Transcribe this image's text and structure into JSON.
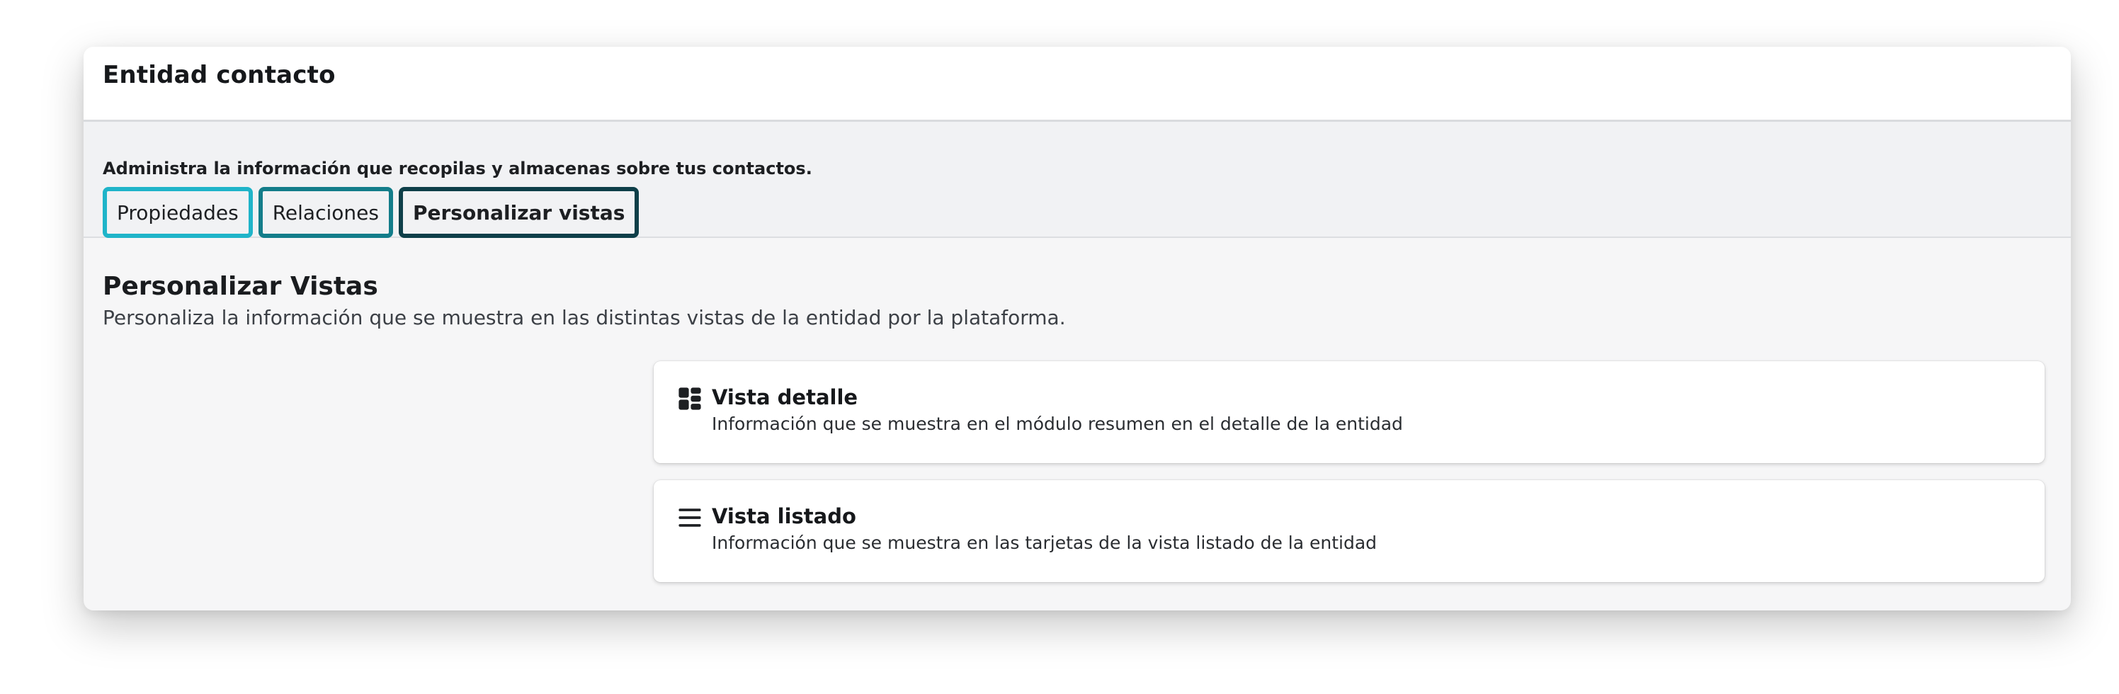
{
  "header": {
    "title": "Entidad contacto"
  },
  "subheader": {
    "description": "Administra la información que recopilas y almacenas sobre tus contactos.",
    "tabs": [
      {
        "label": "Propiedades",
        "color": "#1fb4c9"
      },
      {
        "label": "Relaciones",
        "color": "#137d8a"
      },
      {
        "label": "Personalizar vistas",
        "color": "#0e3f49",
        "active": true
      }
    ]
  },
  "section": {
    "title": "Personalizar Vistas",
    "description": "Personaliza la información que se muestra en las distintas vistas de la entidad por la plataforma."
  },
  "cards": [
    {
      "icon": "dashboard-icon",
      "title": "Vista detalle",
      "description": "Información que se muestra en el módulo resumen en el detalle de la entidad"
    },
    {
      "icon": "list-icon",
      "title": "Vista listado",
      "description": "Información que se muestra en las tarjetas de la vista listado de la entidad"
    }
  ]
}
